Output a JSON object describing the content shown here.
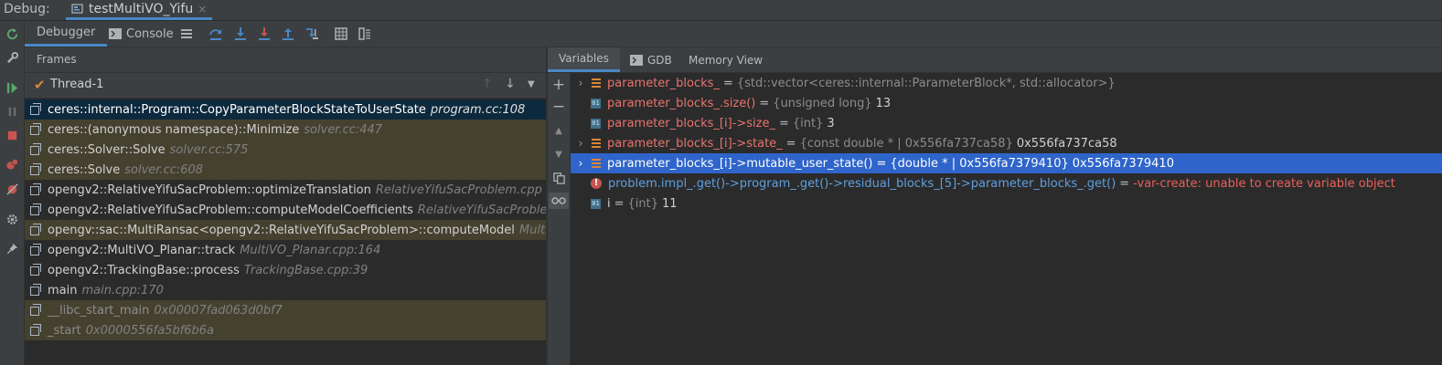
{
  "debug_bar": {
    "label": "Debug:",
    "tab_title": "testMultiVO_Yifu",
    "close_glyph": "×"
  },
  "toolbar": {
    "debugger_tab": "Debugger",
    "console_tab": "Console",
    "icons": [
      "layout-icon",
      "step-over-icon",
      "step-into-icon",
      "force-step-into-icon",
      "step-out-icon",
      "run-to-cursor-icon",
      "evaluate-table-icon",
      "restore-layout-icon"
    ]
  },
  "left_tools": [
    "rerun-icon",
    "settings-wrench-icon",
    "resume-icon",
    "pause-icon",
    "stop-icon",
    "view-breakpoints-icon",
    "mute-breakpoints-icon",
    "gear-icon",
    "pin-icon"
  ],
  "frames": {
    "title": "Frames",
    "thread": "Thread-1",
    "items": [
      {
        "name": "ceres::internal::Program::CopyParameterBlockStateToUserState",
        "loc": "program.cc:108",
        "kind": "sel"
      },
      {
        "name": "ceres::(anonymous namespace)::Minimize",
        "loc": "solver.cc:447",
        "kind": "lib"
      },
      {
        "name": "ceres::Solver::Solve",
        "loc": "solver.cc:575",
        "kind": "lib"
      },
      {
        "name": "ceres::Solve",
        "loc": "solver.cc:608",
        "kind": "lib"
      },
      {
        "name": "opengv2::RelativeYifuSacProblem::optimizeTranslation",
        "loc": "RelativeYifuSacProblem.cpp",
        "kind": ""
      },
      {
        "name": "opengv2::RelativeYifuSacProblem::computeModelCoefficients",
        "loc": "RelativeYifuSacProblem.cpp",
        "kind": ""
      },
      {
        "name": "opengv::sac::MultiRansac<opengv2::RelativeYifuSacProblem>::computeModel",
        "loc": "MultiRansac.hpp",
        "kind": "lib"
      },
      {
        "name": "opengv2::MultiVO_Planar::track",
        "loc": "MultiVO_Planar.cpp:164",
        "kind": ""
      },
      {
        "name": "opengv2::TrackingBase::process",
        "loc": "TrackingBase.cpp:39",
        "kind": ""
      },
      {
        "name": "main",
        "loc": "main.cpp:170",
        "kind": ""
      },
      {
        "name": "__libc_start_main",
        "loc": "0x00007fad063d0bf7",
        "kind": "lib dim"
      },
      {
        "name": "_start",
        "loc": "0x0000556fa5bf6b6a",
        "kind": "lib dim"
      }
    ]
  },
  "variables_panel": {
    "tabs": {
      "variables": "Variables",
      "gdb": "GDB",
      "memory": "Memory View"
    },
    "side_tools": [
      "add-watch-icon",
      "remove-watch-icon",
      "move-up-icon",
      "move-down-icon",
      "copy-icon",
      "watches-glasses-icon"
    ],
    "items": [
      {
        "expand": "›",
        "icon": "field",
        "name": "parameter_blocks_",
        "name_color": "red",
        "type": "{std::vector<ceres::internal::ParameterBlock*, std::allocator>}",
        "value": ""
      },
      {
        "expand": "",
        "icon": "prim",
        "name": "parameter_blocks_.size()",
        "name_color": "red",
        "type": "{unsigned long}",
        "value": "13"
      },
      {
        "expand": "",
        "icon": "prim",
        "name": "parameter_blocks_[i]->size_",
        "name_color": "red",
        "type": "{int}",
        "value": "3"
      },
      {
        "expand": "›",
        "icon": "field",
        "name": "parameter_blocks_[i]->state_",
        "name_color": "red",
        "type": "{const double * | 0x556fa737ca58}",
        "value": "0x556fa737ca58"
      },
      {
        "expand": "›",
        "icon": "field",
        "name": "parameter_blocks_[i]->mutable_user_state()",
        "name_color": "red",
        "type": "{double * | 0x556fa7379410}",
        "value": "0x556fa7379410",
        "selected": true
      },
      {
        "expand": "",
        "icon": "err",
        "name": "problem.impl_.get()->program_.get()->residual_blocks_[5]->parameter_blocks_.get()",
        "name_color": "blue",
        "type": "",
        "value": "",
        "error": "-var-create: unable to create variable object"
      },
      {
        "expand": "",
        "icon": "prim",
        "name": "i",
        "name_color": "white",
        "type": "{int}",
        "value": "11"
      }
    ]
  },
  "colors": {
    "accent": "#4a88c7",
    "selection": "#2f65ca",
    "frame_selected": "#0d293e",
    "library_frame": "#45412f",
    "error": "#e8605b",
    "var_name": "#e8736d"
  }
}
